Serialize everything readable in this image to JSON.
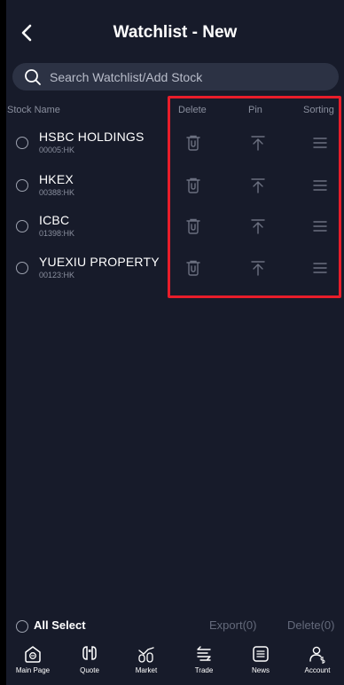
{
  "header": {
    "title": "Watchlist - New"
  },
  "search": {
    "placeholder": "Search Watchlist/Add Stock"
  },
  "columns": {
    "name": "Stock Name",
    "delete": "Delete",
    "pin": "Pin",
    "sorting": "Sorting"
  },
  "stocks": [
    {
      "name": "HSBC HOLDINGS",
      "code": "00005:HK"
    },
    {
      "name": "HKEX",
      "code": "00388:HK"
    },
    {
      "name": "ICBC",
      "code": "01398:HK"
    },
    {
      "name": "YUEXIU PROPERTY",
      "code": "00123:HK"
    }
  ],
  "footer": {
    "all_select": "All Select",
    "export": "Export(0)",
    "delete": "Delete(0)"
  },
  "tabs": [
    {
      "label": "Main Page",
      "icon": "home-icon"
    },
    {
      "label": "Quote",
      "icon": "quote-icon"
    },
    {
      "label": "Market",
      "icon": "market-icon"
    },
    {
      "label": "Trade",
      "icon": "trade-icon"
    },
    {
      "label": "News",
      "icon": "news-icon"
    },
    {
      "label": "Account",
      "icon": "account-icon"
    }
  ],
  "colors": {
    "background": "#171b2a",
    "highlight": "#e81d2a",
    "muted": "#8a8f9e"
  }
}
